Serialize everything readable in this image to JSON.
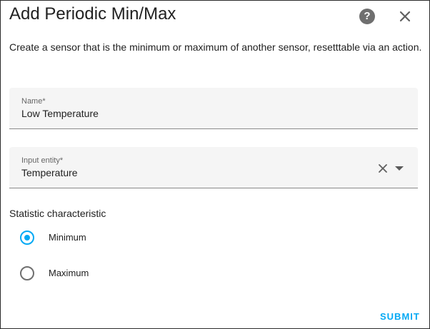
{
  "dialog": {
    "title": "Add Periodic Min/Max",
    "help_icon": "help-circle-icon",
    "close_icon": "close-icon",
    "description": "Create a sensor that is the minimum or maximum of another sensor, resetttable via an action."
  },
  "form": {
    "name": {
      "label": "Name*",
      "value": "Low Temperature"
    },
    "input_entity": {
      "label": "Input entity*",
      "value": "Temperature"
    },
    "statistic": {
      "label": "Statistic characteristic",
      "options": [
        {
          "label": "Minimum",
          "selected": true
        },
        {
          "label": "Maximum",
          "selected": false
        }
      ]
    }
  },
  "actions": {
    "submit_label": "SUBMIT"
  },
  "colors": {
    "accent": "#03a9f4",
    "field_bg": "#f5f5f5",
    "text": "#212121"
  }
}
